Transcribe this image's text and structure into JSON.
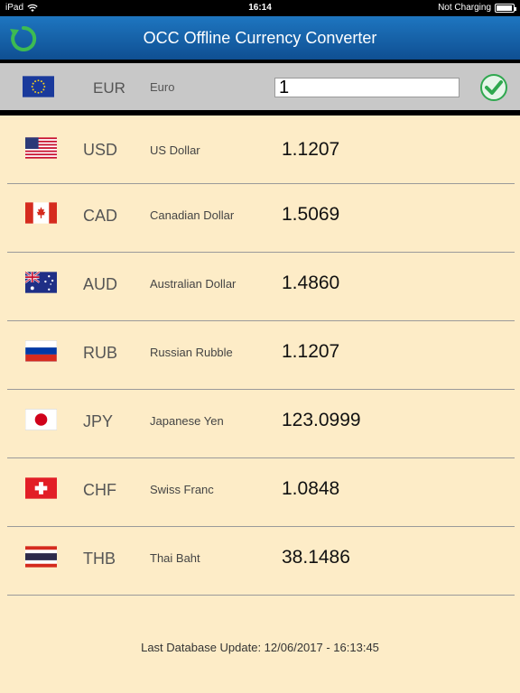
{
  "status": {
    "device": "iPad",
    "time": "16:14",
    "charging": "Not Charging"
  },
  "header": {
    "title": "OCC Offline Currency Converter",
    "refresh_icon": "refresh-icon"
  },
  "base": {
    "code": "EUR",
    "name": "Euro",
    "amount": "1",
    "flag": "eu-flag",
    "confirm_icon": "checkmark-icon"
  },
  "rates": [
    {
      "code": "USD",
      "name": "US Dollar",
      "value": "1.1207",
      "flag": "us-flag"
    },
    {
      "code": "CAD",
      "name": "Canadian Dollar",
      "value": "1.5069",
      "flag": "ca-flag"
    },
    {
      "code": "AUD",
      "name": "Australian Dollar",
      "value": "1.4860",
      "flag": "au-flag"
    },
    {
      "code": "RUB",
      "name": "Russian Rubble",
      "value": "1.1207",
      "flag": "ru-flag"
    },
    {
      "code": "JPY",
      "name": "Japanese Yen",
      "value": "123.0999",
      "flag": "jp-flag"
    },
    {
      "code": "CHF",
      "name": "Swiss Franc",
      "value": "1.0848",
      "flag": "ch-flag"
    },
    {
      "code": "THB",
      "name": "Thai Baht",
      "value": "38.1486",
      "flag": "th-flag"
    }
  ],
  "footer": {
    "last_update": "Last Database Update: 12/06/2017 - 16:13:45"
  },
  "colors": {
    "header": "#1565b0",
    "background": "#fdecc7",
    "base_bar": "#c8c8c8",
    "accent_green": "#2fa84f"
  }
}
